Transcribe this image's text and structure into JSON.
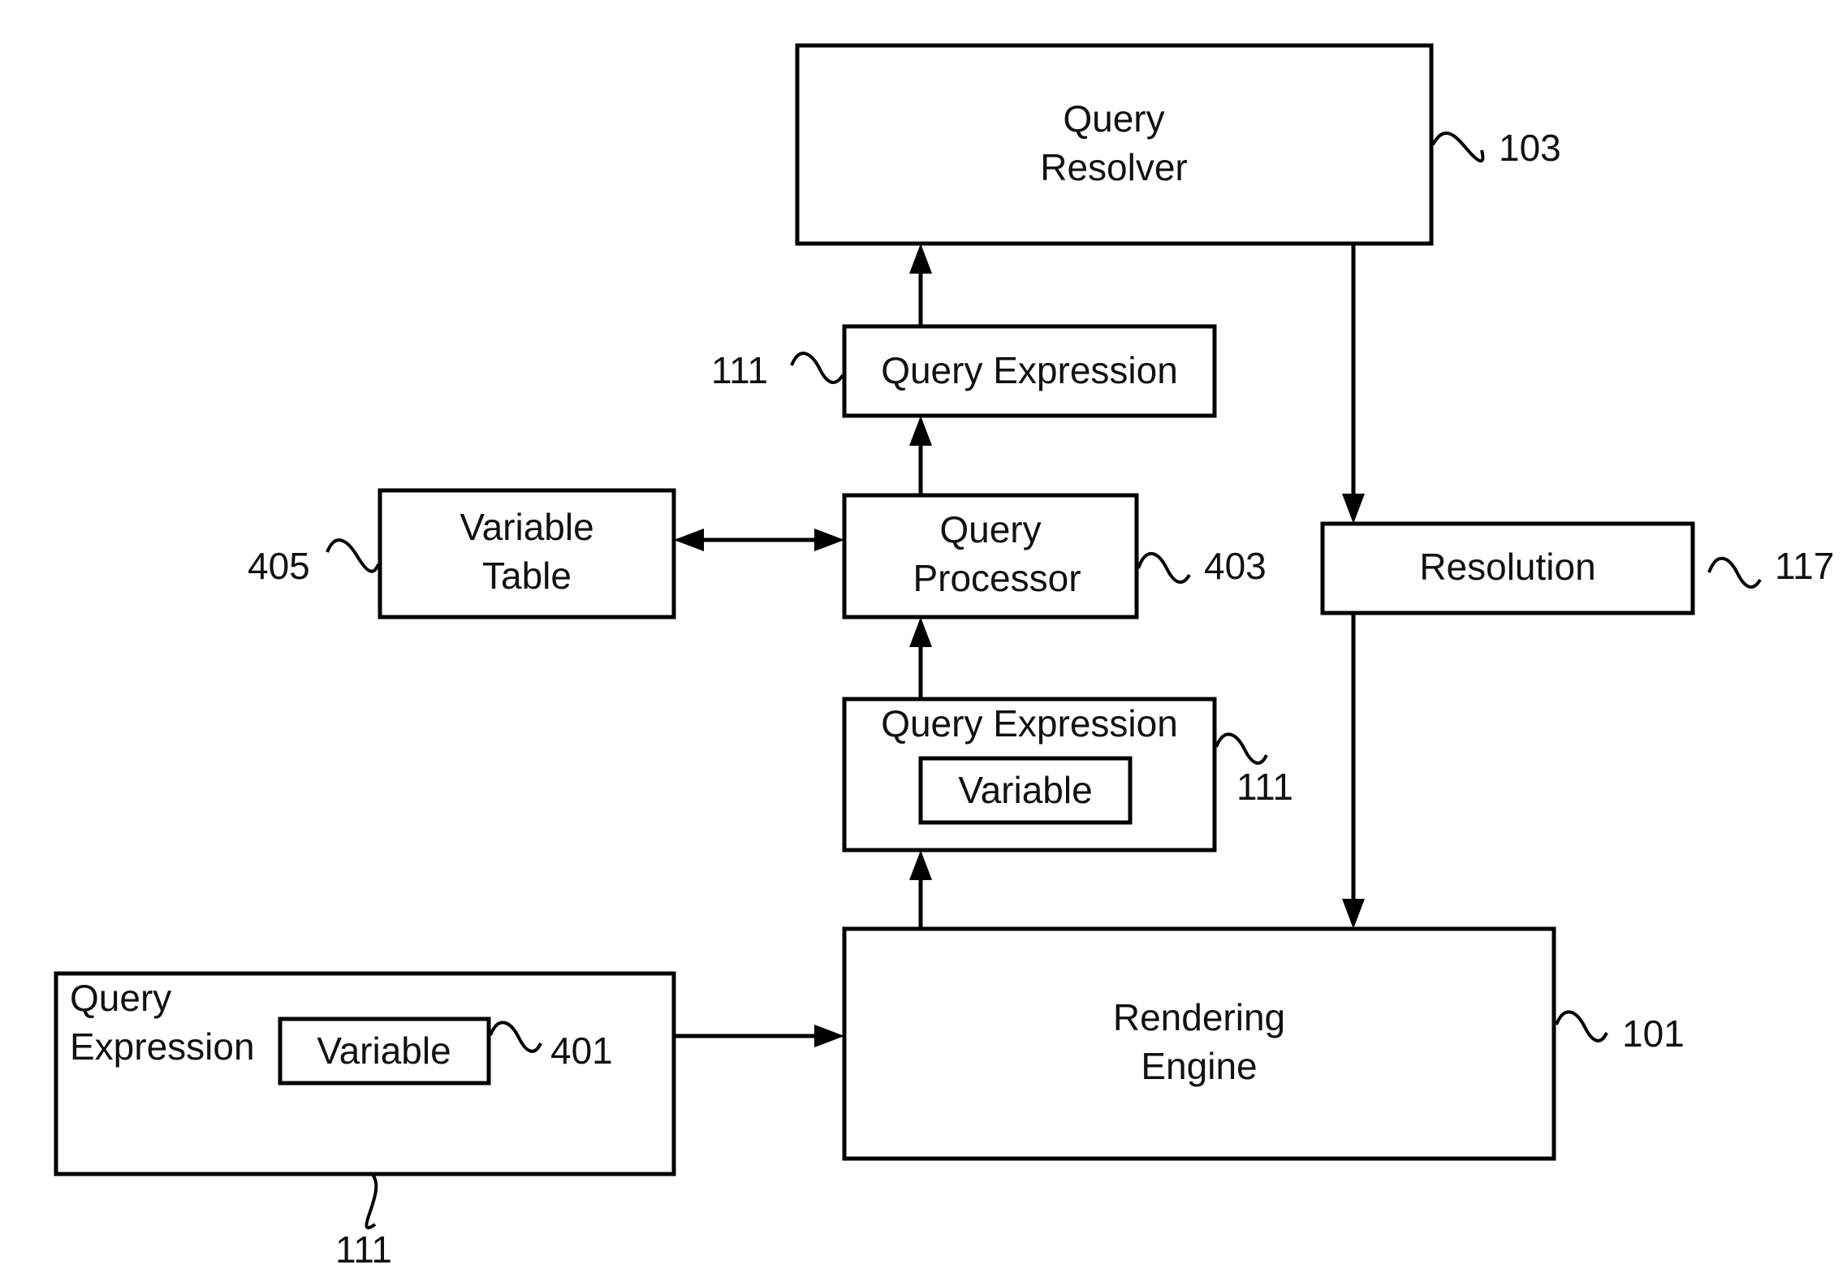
{
  "diagram": {
    "nodes": {
      "query_resolver": {
        "lines": [
          "Query",
          "Resolver"
        ],
        "ref": "103"
      },
      "query_expression_top": {
        "lines": [
          "Query Expression"
        ],
        "ref": "111"
      },
      "variable_table": {
        "lines": [
          "Variable",
          "Table"
        ],
        "ref": "405"
      },
      "query_processor": {
        "lines": [
          "Query",
          "Processor"
        ],
        "ref": "403"
      },
      "resolution": {
        "lines": [
          "Resolution"
        ],
        "ref": "117"
      },
      "query_expression_mid": {
        "lines": [
          "Query Expression"
        ],
        "inner": "Variable",
        "ref": "111"
      },
      "rendering_engine": {
        "lines": [
          "Rendering",
          "Engine"
        ],
        "ref": "101"
      },
      "query_expression_left": {
        "lines": [
          "Query",
          "Expression"
        ],
        "inner": "Variable",
        "inner_ref": "401",
        "ref": "111"
      }
    },
    "edges": [
      {
        "from": "query_expression_left",
        "to": "rendering_engine",
        "type": "arrow"
      },
      {
        "from": "rendering_engine",
        "to": "query_expression_mid",
        "type": "arrow"
      },
      {
        "from": "query_expression_mid",
        "to": "query_processor",
        "type": "arrow"
      },
      {
        "from": "query_processor",
        "to": "variable_table",
        "type": "bidirectional"
      },
      {
        "from": "query_processor",
        "to": "query_expression_top",
        "type": "arrow"
      },
      {
        "from": "query_expression_top",
        "to": "query_resolver",
        "type": "arrow"
      },
      {
        "from": "query_resolver",
        "to": "resolution",
        "type": "arrow"
      },
      {
        "from": "resolution",
        "to": "rendering_engine",
        "type": "arrow"
      }
    ]
  }
}
